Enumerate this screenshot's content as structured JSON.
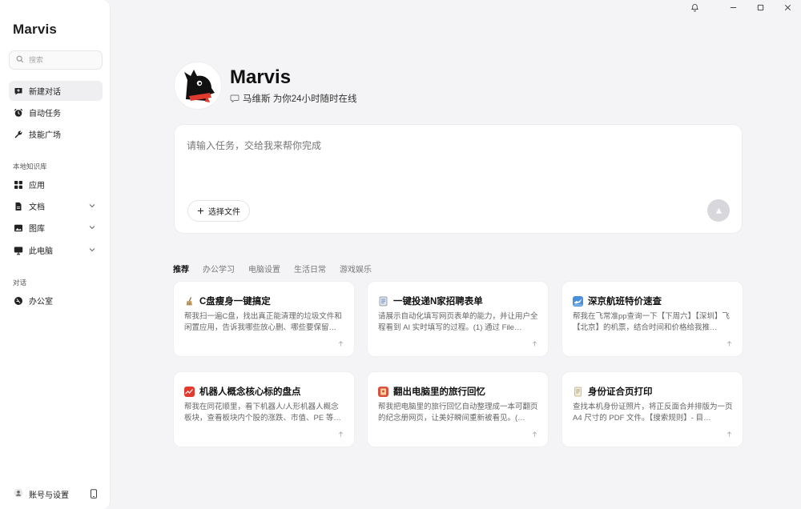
{
  "window": {
    "controls": [
      "bell-icon",
      "minimize-icon",
      "maximize-icon",
      "close-icon"
    ]
  },
  "sidebar": {
    "brand": "Marvis",
    "search": {
      "placeholder": "搜索"
    },
    "primary": [
      {
        "label": "新建对话",
        "icon": "chat-plus-icon",
        "active": true
      },
      {
        "label": "自动任务",
        "icon": "alarm-clock-icon"
      },
      {
        "label": "技能广场",
        "icon": "wrench-icon"
      }
    ],
    "knowledge_label": "本地知识库",
    "knowledge": [
      {
        "label": "应用",
        "icon": "apps-grid-icon",
        "expandable": false
      },
      {
        "label": "文档",
        "icon": "document-icon",
        "expandable": true
      },
      {
        "label": "图库",
        "icon": "image-icon",
        "expandable": true
      },
      {
        "label": "此电脑",
        "icon": "monitor-icon",
        "expandable": true
      }
    ],
    "dialog_label": "对话",
    "dialogs": [
      {
        "label": "办公室",
        "icon": "office-icon"
      }
    ],
    "account": {
      "label": "账号与设置",
      "icon": "user-icon",
      "device_icon": "phone-icon"
    }
  },
  "profile": {
    "name": "Marvis",
    "tagline": "马维斯 为你24小时随时在线",
    "tag_icon": "speech-bubble-icon"
  },
  "composer": {
    "placeholder": "请输入任务，交给我来帮你完成",
    "file_button": "选择文件",
    "send_icon": "send-arrow-icon"
  },
  "tabs": [
    {
      "label": "推荐",
      "active": true
    },
    {
      "label": "办公学习"
    },
    {
      "label": "电脑设置"
    },
    {
      "label": "生活日常"
    },
    {
      "label": "游戏娱乐"
    }
  ],
  "cards": [
    {
      "title": "C盘瘦身一键搞定",
      "icon": "broom-icon",
      "desc": "帮我扫一遍C盘，找出真正能清理的垃圾文件和闲置应用，告诉我哪些放心删、哪些要保留…"
    },
    {
      "title": "一键投递N家招聘表单",
      "icon": "form-icon",
      "desc": "请展示自动化填写网页表单的能力，并让用户全程看到 AI 实时填写的过程。(1) 通过 File…"
    },
    {
      "title": "深京航班特价速查",
      "icon": "plane-icon",
      "desc": "帮我在飞常准pp查询一下【下周六】【深圳】飞【北京】的机票，结合时间和价格给我推…"
    },
    {
      "title": "机器人概念核心标的盘点",
      "icon": "stock-chart-icon",
      "desc": "帮我在同花顺里，看下机器人/人形机器人概念板块，查看板块内个股的涨跌、市值、PE 等…"
    },
    {
      "title": "翻出电脑里的旅行回忆",
      "icon": "album-icon",
      "desc": "帮我把电脑里的旅行回忆自动整理成一本可翻页的纪念册网页，让美好瞬间重新被看见。(…"
    },
    {
      "title": "身份证合页打印",
      "icon": "id-card-icon",
      "desc": "查找本机身份证照片，将正反面合并排版为一页 A4 尺寸的 PDF 文件。【搜索规则】- 目…"
    }
  ],
  "colors": {
    "accent_red": "#e03b2e",
    "sidebar_bg": "#ffffff",
    "page_bg": "#f4f4f6"
  }
}
